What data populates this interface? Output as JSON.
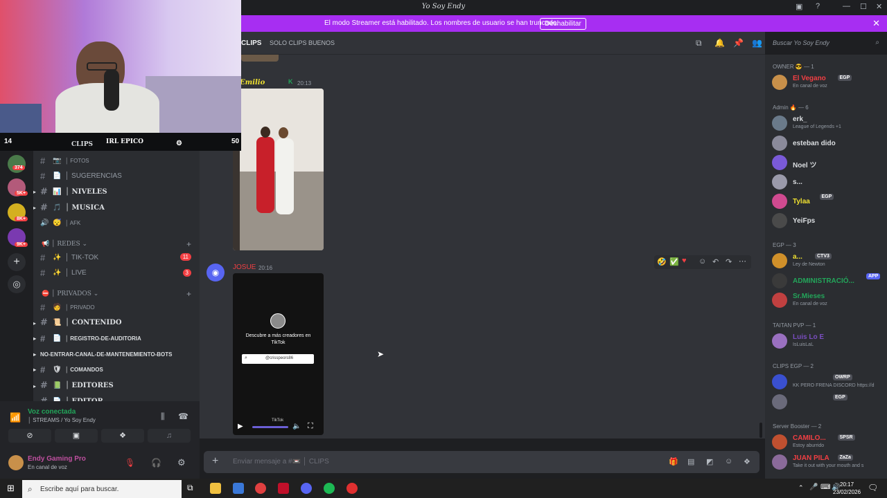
{
  "app_title": "Yo Soy Endy",
  "banner": {
    "message": "El modo Streamer está habilitado. Los nombres de usuario se han truncado.",
    "button": "Deshabilitar"
  },
  "stream_overlay": {
    "left_count": "14",
    "channel_tag": "CLIPS",
    "label": "IRL EPICO",
    "right_count": "50"
  },
  "channel_header": {
    "name": "CLIPS",
    "topic": "SOLO CLIPS BUENOS"
  },
  "search": {
    "placeholder": "Buscar Yo Soy Endy"
  },
  "guild_badges": [
    "374",
    "5K+",
    "8K+",
    "9K+"
  ],
  "channels": [
    {
      "emoji": "📷",
      "name": "│ FOTOS",
      "style": "small"
    },
    {
      "emoji": "📄",
      "name": "│ SUGERENCIAS",
      "style": "normal"
    },
    {
      "emoji": "📊",
      "name": "│ NIVELES",
      "style": "bold",
      "expand": true
    },
    {
      "emoji": "🎵",
      "name": "│ MUSICA",
      "style": "bold",
      "expand": true
    },
    {
      "emoji": "😴",
      "name": "│ AFK",
      "style": "small",
      "voice": true
    }
  ],
  "category_redes": "│ REDES",
  "redes_channels": [
    {
      "emoji": "✨",
      "name": "│ TIK-TOK",
      "badge": "11"
    },
    {
      "emoji": "✨",
      "name": "│ LIVE",
      "badge": "3"
    }
  ],
  "category_privados": "│ PRIVADOS",
  "privados_channels": [
    {
      "emoji": "🧑",
      "name": "│ PRIVADO",
      "style": "small"
    },
    {
      "emoji": "📜",
      "name": "│ CONTENIDO",
      "style": "bold",
      "expand": true
    },
    {
      "emoji": "📄",
      "name": "│ REGISTRO-DE-AUDITORIA",
      "style": "small-bold",
      "expand": true
    },
    {
      "emoji": "",
      "name": "NO-ENTRAR-CANAL-DE-MANTENEMIENTO-BOTS",
      "style": "small-bold",
      "expand": true,
      "nohash": true
    },
    {
      "emoji": "🛡",
      "name": "│ COMANDOS",
      "style": "small-bold",
      "expand": true
    },
    {
      "emoji": "📗",
      "name": "│ EDITORES",
      "style": "bold",
      "expand": true
    },
    {
      "emoji": "📄",
      "name": "│ EDITOR",
      "style": "bold"
    }
  ],
  "voice": {
    "status": "Voz conectada",
    "channel": "│ STREAMS / Yo Soy Endy"
  },
  "user": {
    "name": "Endy Gaming Pro",
    "status": "En canal de voz"
  },
  "messages": {
    "msg1_author": "Emilio",
    "msg1_time": "20:13",
    "msg2_author": "JOSUE",
    "msg2_time": "20:16",
    "tiktok_prompt": "Descubre a más creadores en TikTok",
    "tiktok_search": "@crisspeors86",
    "tiktok_brand": "TikTok"
  },
  "composer": {
    "placeholder": "Enviar mensaje a #📼 │ CLIPS"
  },
  "member_groups": [
    {
      "title": "OWNER 😎 — 1",
      "members": [
        {
          "name": "El Vegano",
          "tag": "EGP",
          "status": "En canal de voz",
          "color": "#f23f43"
        }
      ]
    },
    {
      "title": "Admin 🔥 — 6",
      "members": [
        {
          "name": "erk_",
          "status": "League of Legends +1",
          "color": "#dbdee1"
        },
        {
          "name": "esteban dido",
          "status": "",
          "color": "#dbdee1"
        },
        {
          "name": "Noel ツ",
          "status": "",
          "color": "#dbdee1"
        },
        {
          "name": "s...",
          "status": "",
          "color": "#dbdee1"
        },
        {
          "name": "Tylaa",
          "tag": "EGP",
          "status": "",
          "color": "#f0e130"
        },
        {
          "name": "YeiFps",
          "status": "",
          "color": "#dbdee1"
        }
      ]
    },
    {
      "title": "EGP — 3",
      "members": [
        {
          "name": "a...",
          "tag": "CTV3",
          "status": "Ley de Newton",
          "color": "#f0e130"
        },
        {
          "name": "ADMINISTRACIÓ...",
          "tag": "APP",
          "status": "",
          "color": "#23a55a"
        },
        {
          "name": "Sr.Mieses",
          "status": "En canal de voz",
          "color": "#23a55a"
        }
      ]
    },
    {
      "title": "TAITAN PVP — 1",
      "members": [
        {
          "name": "Luis Lo E",
          "status": "IsLuisLaL",
          "color": "#7a4dbf"
        }
      ]
    },
    {
      "title": "CLIPS EGP — 2",
      "members": [
        {
          "name": "",
          "tag": "OWRP",
          "status": "KK PERO FRENA DISCORD https://d",
          "color": "#3d5afe"
        },
        {
          "name": "",
          "tag": "EGP",
          "status": "",
          "color": "#3d5afe"
        }
      ]
    },
    {
      "title": "Server Booster — 2",
      "members": [
        {
          "name": "CAMILO...",
          "tag": "SPSR",
          "status": "Estoy aburrido",
          "color": "#f23f43"
        },
        {
          "name": "JUAN PILA",
          "tag": "ZaZa",
          "status": "Take it out with your mouth and s",
          "color": "#f23f43"
        }
      ]
    }
  ],
  "taskbar": {
    "search_placeholder": "Escribe aquí para buscar.",
    "time": "20:17",
    "date": "23/02/2026"
  }
}
